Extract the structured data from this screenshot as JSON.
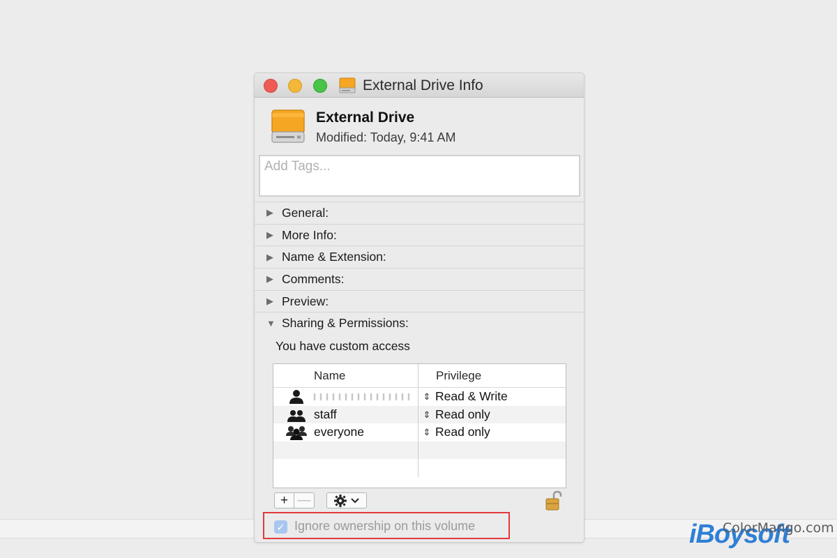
{
  "window": {
    "title": "External Drive Info",
    "traffic_lights": [
      "close",
      "minimize",
      "zoom"
    ]
  },
  "header": {
    "name": "External Drive",
    "modified": "Modified:  Today, 9:41 AM"
  },
  "tags": {
    "placeholder": "Add Tags..."
  },
  "sections": [
    {
      "label": "General:",
      "expanded": false
    },
    {
      "label": "More Info:",
      "expanded": false
    },
    {
      "label": "Name & Extension:",
      "expanded": false
    },
    {
      "label": "Comments:",
      "expanded": false
    },
    {
      "label": "Preview:",
      "expanded": false
    },
    {
      "label": "Sharing & Permissions:",
      "expanded": true
    }
  ],
  "permissions": {
    "access_text": "You have custom access",
    "columns": {
      "name": "Name",
      "privilege": "Privilege"
    },
    "rows": [
      {
        "name": "",
        "icon": "single-user-icon",
        "privilege": "Read & Write",
        "redacted": true
      },
      {
        "name": "staff",
        "icon": "group-icon",
        "privilege": "Read only"
      },
      {
        "name": "everyone",
        "icon": "everyone-icon",
        "privilege": "Read only"
      }
    ],
    "toolbar": {
      "add": "+",
      "remove": "—"
    },
    "ignore_ownership": {
      "label": "Ignore ownership on this volume",
      "checked": true
    }
  },
  "watermark": {
    "brand": "iBoysoft",
    "overlay": "ColorMango.com"
  },
  "colors": {
    "highlight_box": "#e2393b",
    "checkbox": "#a9c6ef",
    "drive_orange": "#f5a623"
  }
}
